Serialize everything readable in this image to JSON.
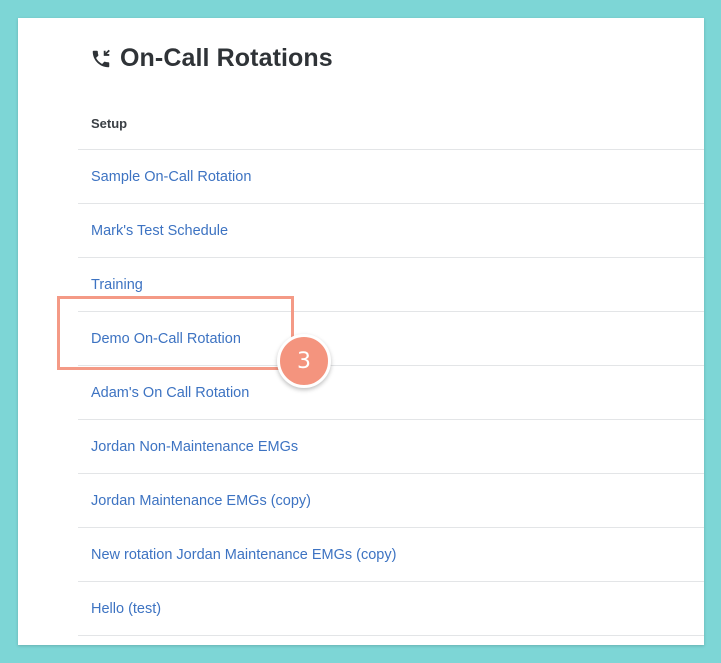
{
  "header": {
    "icon": "phone-forward-icon",
    "title": "On-Call Rotations"
  },
  "section": {
    "label": "Setup"
  },
  "rotations": [
    {
      "label": "Sample On-Call Rotation"
    },
    {
      "label": "Mark's Test Schedule"
    },
    {
      "label": "Training"
    },
    {
      "label": "Demo On-Call Rotation"
    },
    {
      "label": "Adam's On Call Rotation"
    },
    {
      "label": "Jordan Non-Maintenance EMGs"
    },
    {
      "label": "Jordan Maintenance EMGs (copy)"
    },
    {
      "label": "New rotation Jordan Maintenance EMGs (copy)"
    },
    {
      "label": "Hello (test)"
    }
  ],
  "annotation": {
    "step_number": "3",
    "highlight_color": "#f49a86"
  },
  "colors": {
    "background": "#7dd6d6",
    "link": "#3d73c2",
    "title": "#2f3337"
  }
}
